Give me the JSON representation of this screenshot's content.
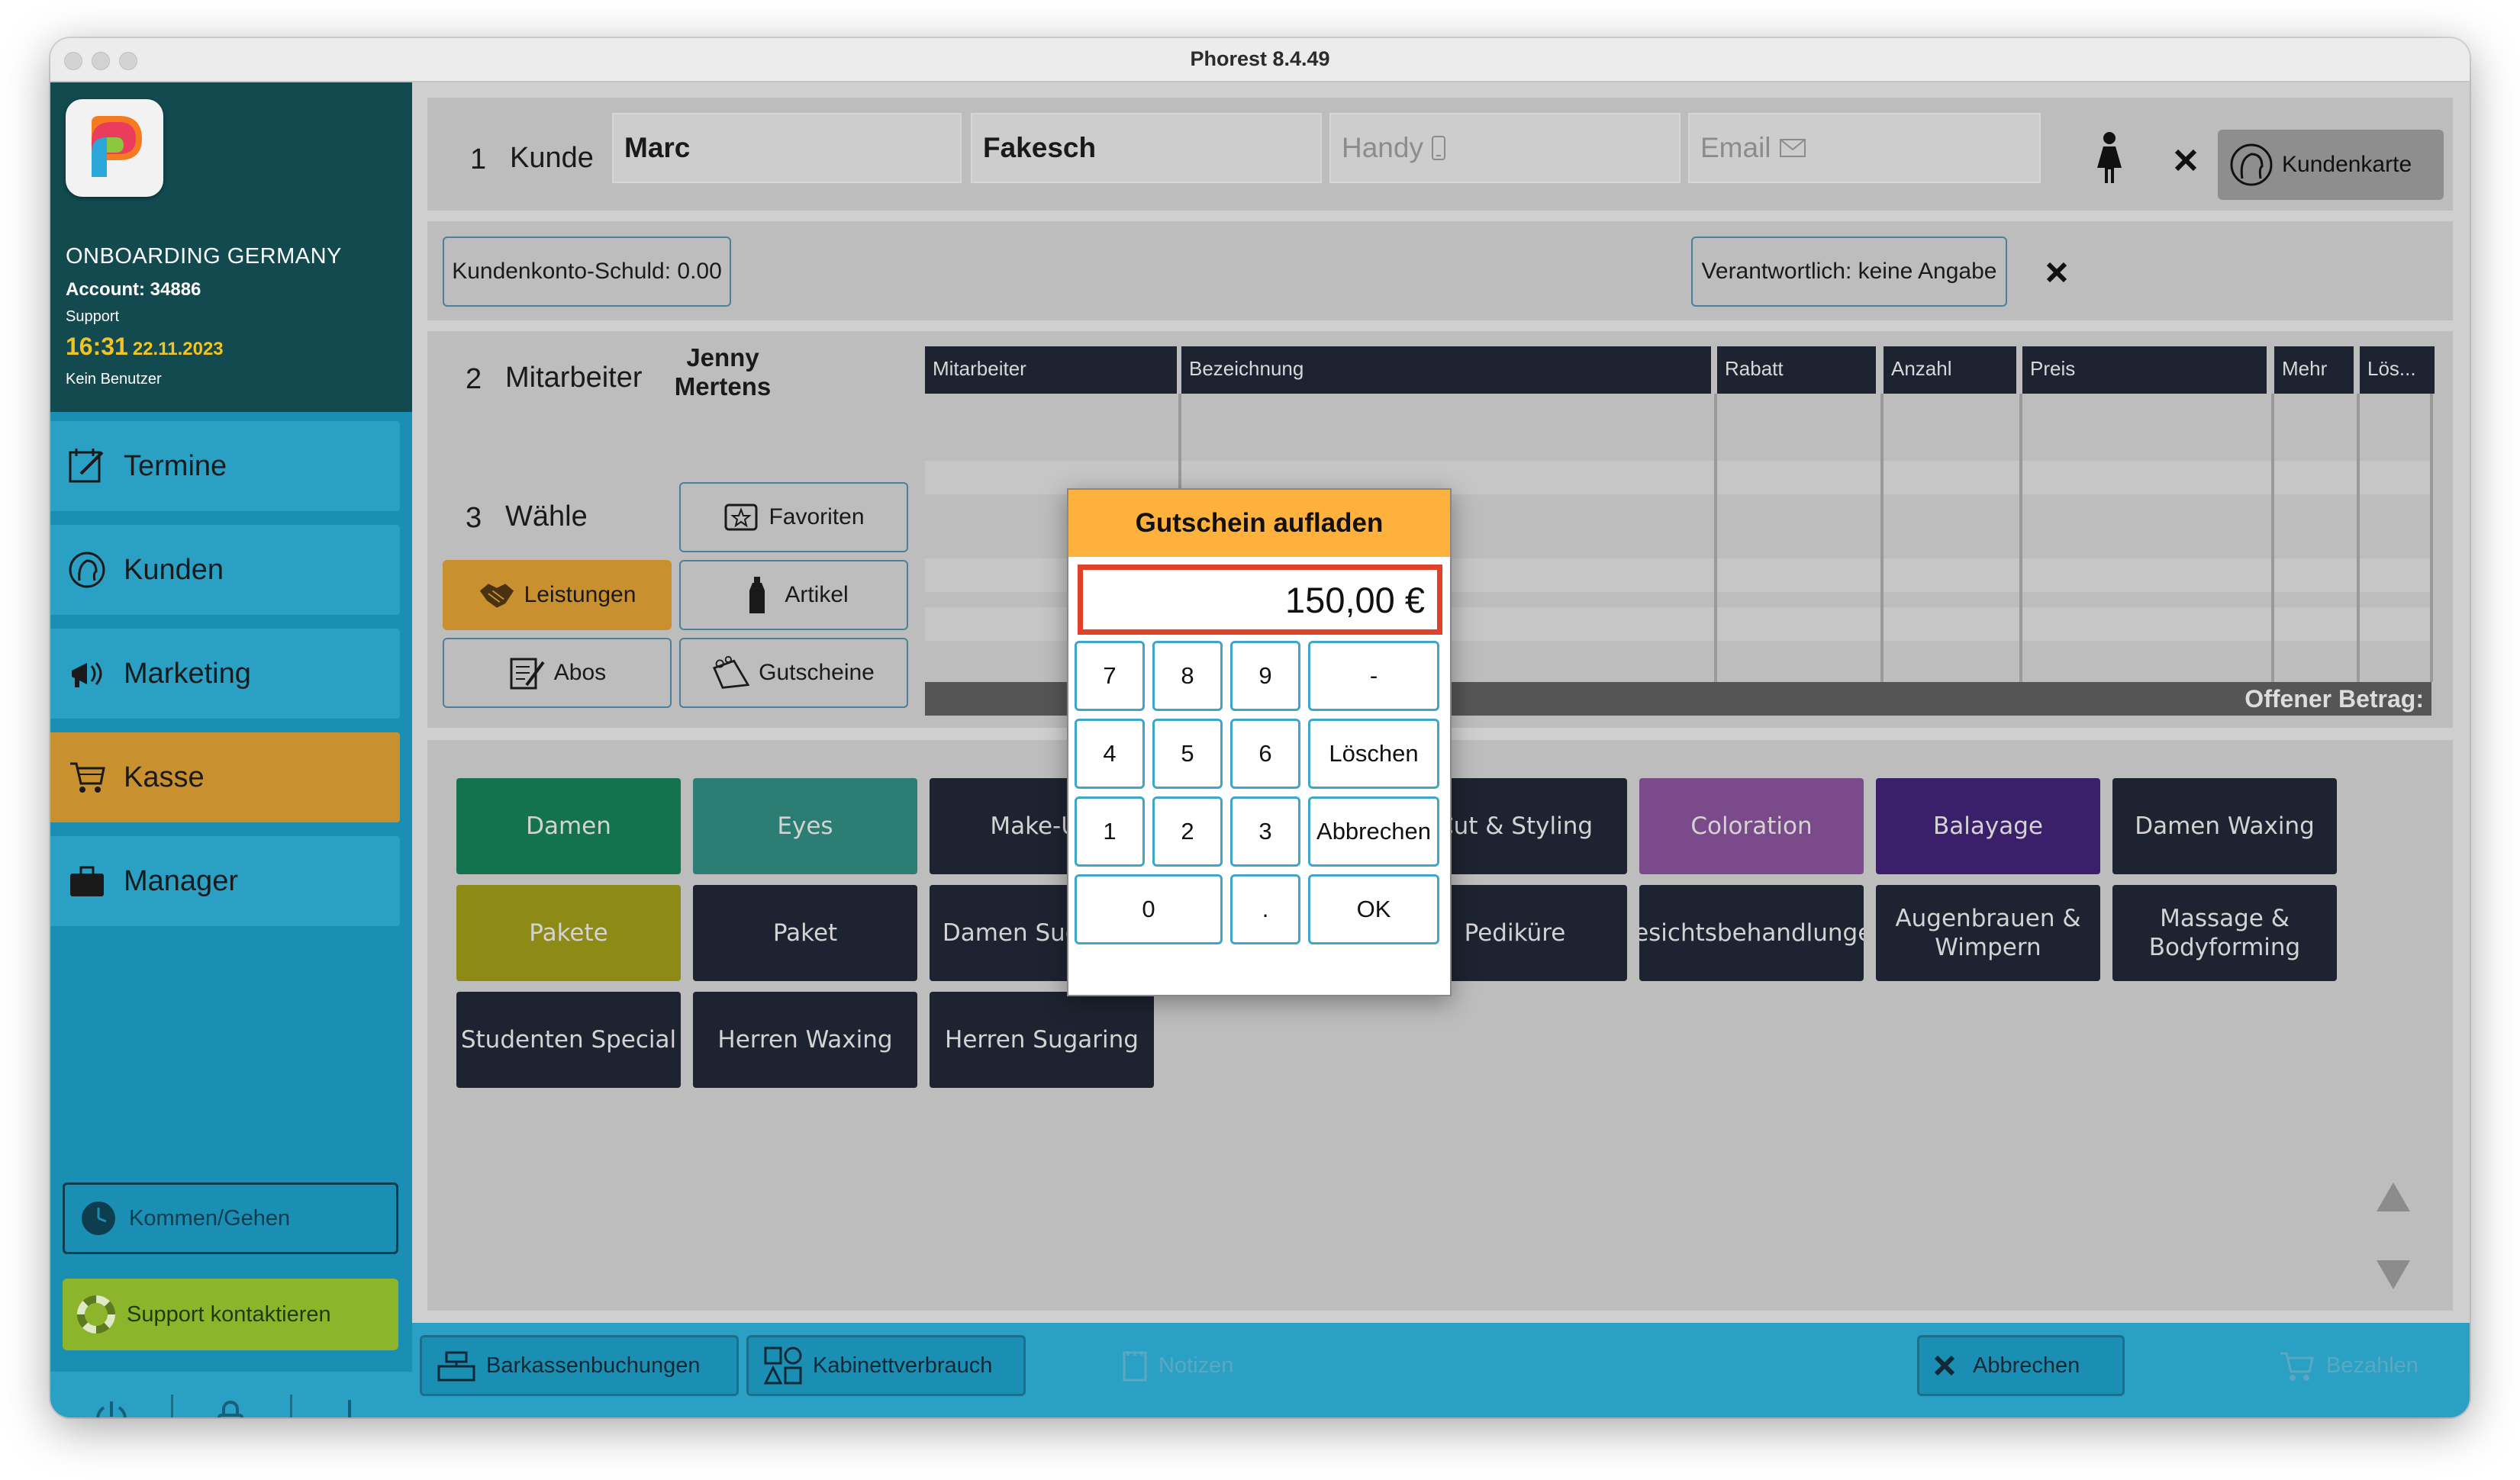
{
  "window": {
    "title": "Phorest 8.4.49"
  },
  "sidebar": {
    "org": "ONBOARDING GERMANY",
    "account": "Account: 34886",
    "role": "Support",
    "time": "16:31",
    "date": "22.11.2023",
    "user": "Kein Benutzer",
    "nav": [
      {
        "label": "Termine",
        "icon": "calendar-edit-icon"
      },
      {
        "label": "Kunden",
        "icon": "client-head-icon"
      },
      {
        "label": "Marketing",
        "icon": "megaphone-icon"
      },
      {
        "label": "Kasse",
        "icon": "cart-icon"
      },
      {
        "label": "Manager",
        "icon": "briefcase-icon"
      }
    ],
    "kommen_gehen": "Kommen/Gehen",
    "support": "Support kontaktieren"
  },
  "kunde": {
    "number": "1",
    "label": "Kunde",
    "first_name": "Marc",
    "last_name": "Fakesch",
    "handy_placeholder": "Handy",
    "email_placeholder": "Email",
    "kundenkarte": "Kundenkarte"
  },
  "konto": {
    "schuld": "Kundenkonto-Schuld: 0.00",
    "verantwortlich": "Verantwortlich: keine Angabe"
  },
  "mitarbeiter": {
    "number": "2",
    "label": "Mitarbeiter",
    "first": "Jenny",
    "last": "Mertens"
  },
  "waehle": {
    "number": "3",
    "label": "Wähle",
    "buttons": {
      "favoriten": "Favoriten",
      "leistungen": "Leistungen",
      "artikel": "Artikel",
      "abos": "Abos",
      "gutscheine": "Gutscheine"
    }
  },
  "table": {
    "headers": [
      "Mitarbeiter",
      "Bezeichnung",
      "Rabatt",
      "Anzahl",
      "Preis",
      "Mehr",
      "Lös..."
    ],
    "open_amount_label": "Offener Betrag:"
  },
  "services": [
    {
      "label": "Damen",
      "color": "#13734f"
    },
    {
      "label": "Eyes",
      "color": "#2c7d73"
    },
    {
      "label": "Make-Up",
      "color": "#1d2330"
    },
    {
      "label": "",
      "color": "#1d2330"
    },
    {
      "label": "Cut & Styling",
      "color": "#1d2330"
    },
    {
      "label": "Coloration",
      "color": "#7a4a8a"
    },
    {
      "label": "Balayage",
      "color": "#3a1f6b"
    },
    {
      "label": "Damen Waxing",
      "color": "#1d2330"
    },
    {
      "label": "Pakete",
      "color": "#8d8a16"
    },
    {
      "label": "Paket",
      "color": "#1d2330"
    },
    {
      "label": "Damen Sugaring",
      "color": "#1d2330"
    },
    {
      "label": "",
      "color": "#1d2330"
    },
    {
      "label": "Pediküre",
      "color": "#1d2330"
    },
    {
      "label": "Gesichtsbehandlungen",
      "color": "#1d2330"
    },
    {
      "label": "Augenbrauen & Wimpern",
      "color": "#1d2330"
    },
    {
      "label": "Massage & Bodyforming",
      "color": "#1d2330"
    },
    {
      "label": "Studenten Special",
      "color": "#1d2330"
    },
    {
      "label": "Herren Waxing",
      "color": "#1d2330"
    },
    {
      "label": "Herren Sugaring",
      "color": "#1d2330"
    }
  ],
  "bottombar": {
    "barkasse": "Barkassenbuchungen",
    "kabinett": "Kabinettverbrauch",
    "notizen": "Notizen",
    "abbrechen": "Abbrechen",
    "bezahlen": "Bezahlen"
  },
  "modal": {
    "title": "Gutschein aufladen",
    "value": "150,00 €",
    "keys": [
      "7",
      "8",
      "9",
      "-",
      "4",
      "5",
      "6",
      "Löschen",
      "1",
      "2",
      "3",
      "Abbrechen",
      "0",
      ".",
      "OK"
    ]
  },
  "colors": {
    "accent_orange": "#c8902e",
    "sidebar_blue": "#1b8fb3",
    "modal_header": "#ffb13d",
    "display_border": "#e0412b"
  }
}
